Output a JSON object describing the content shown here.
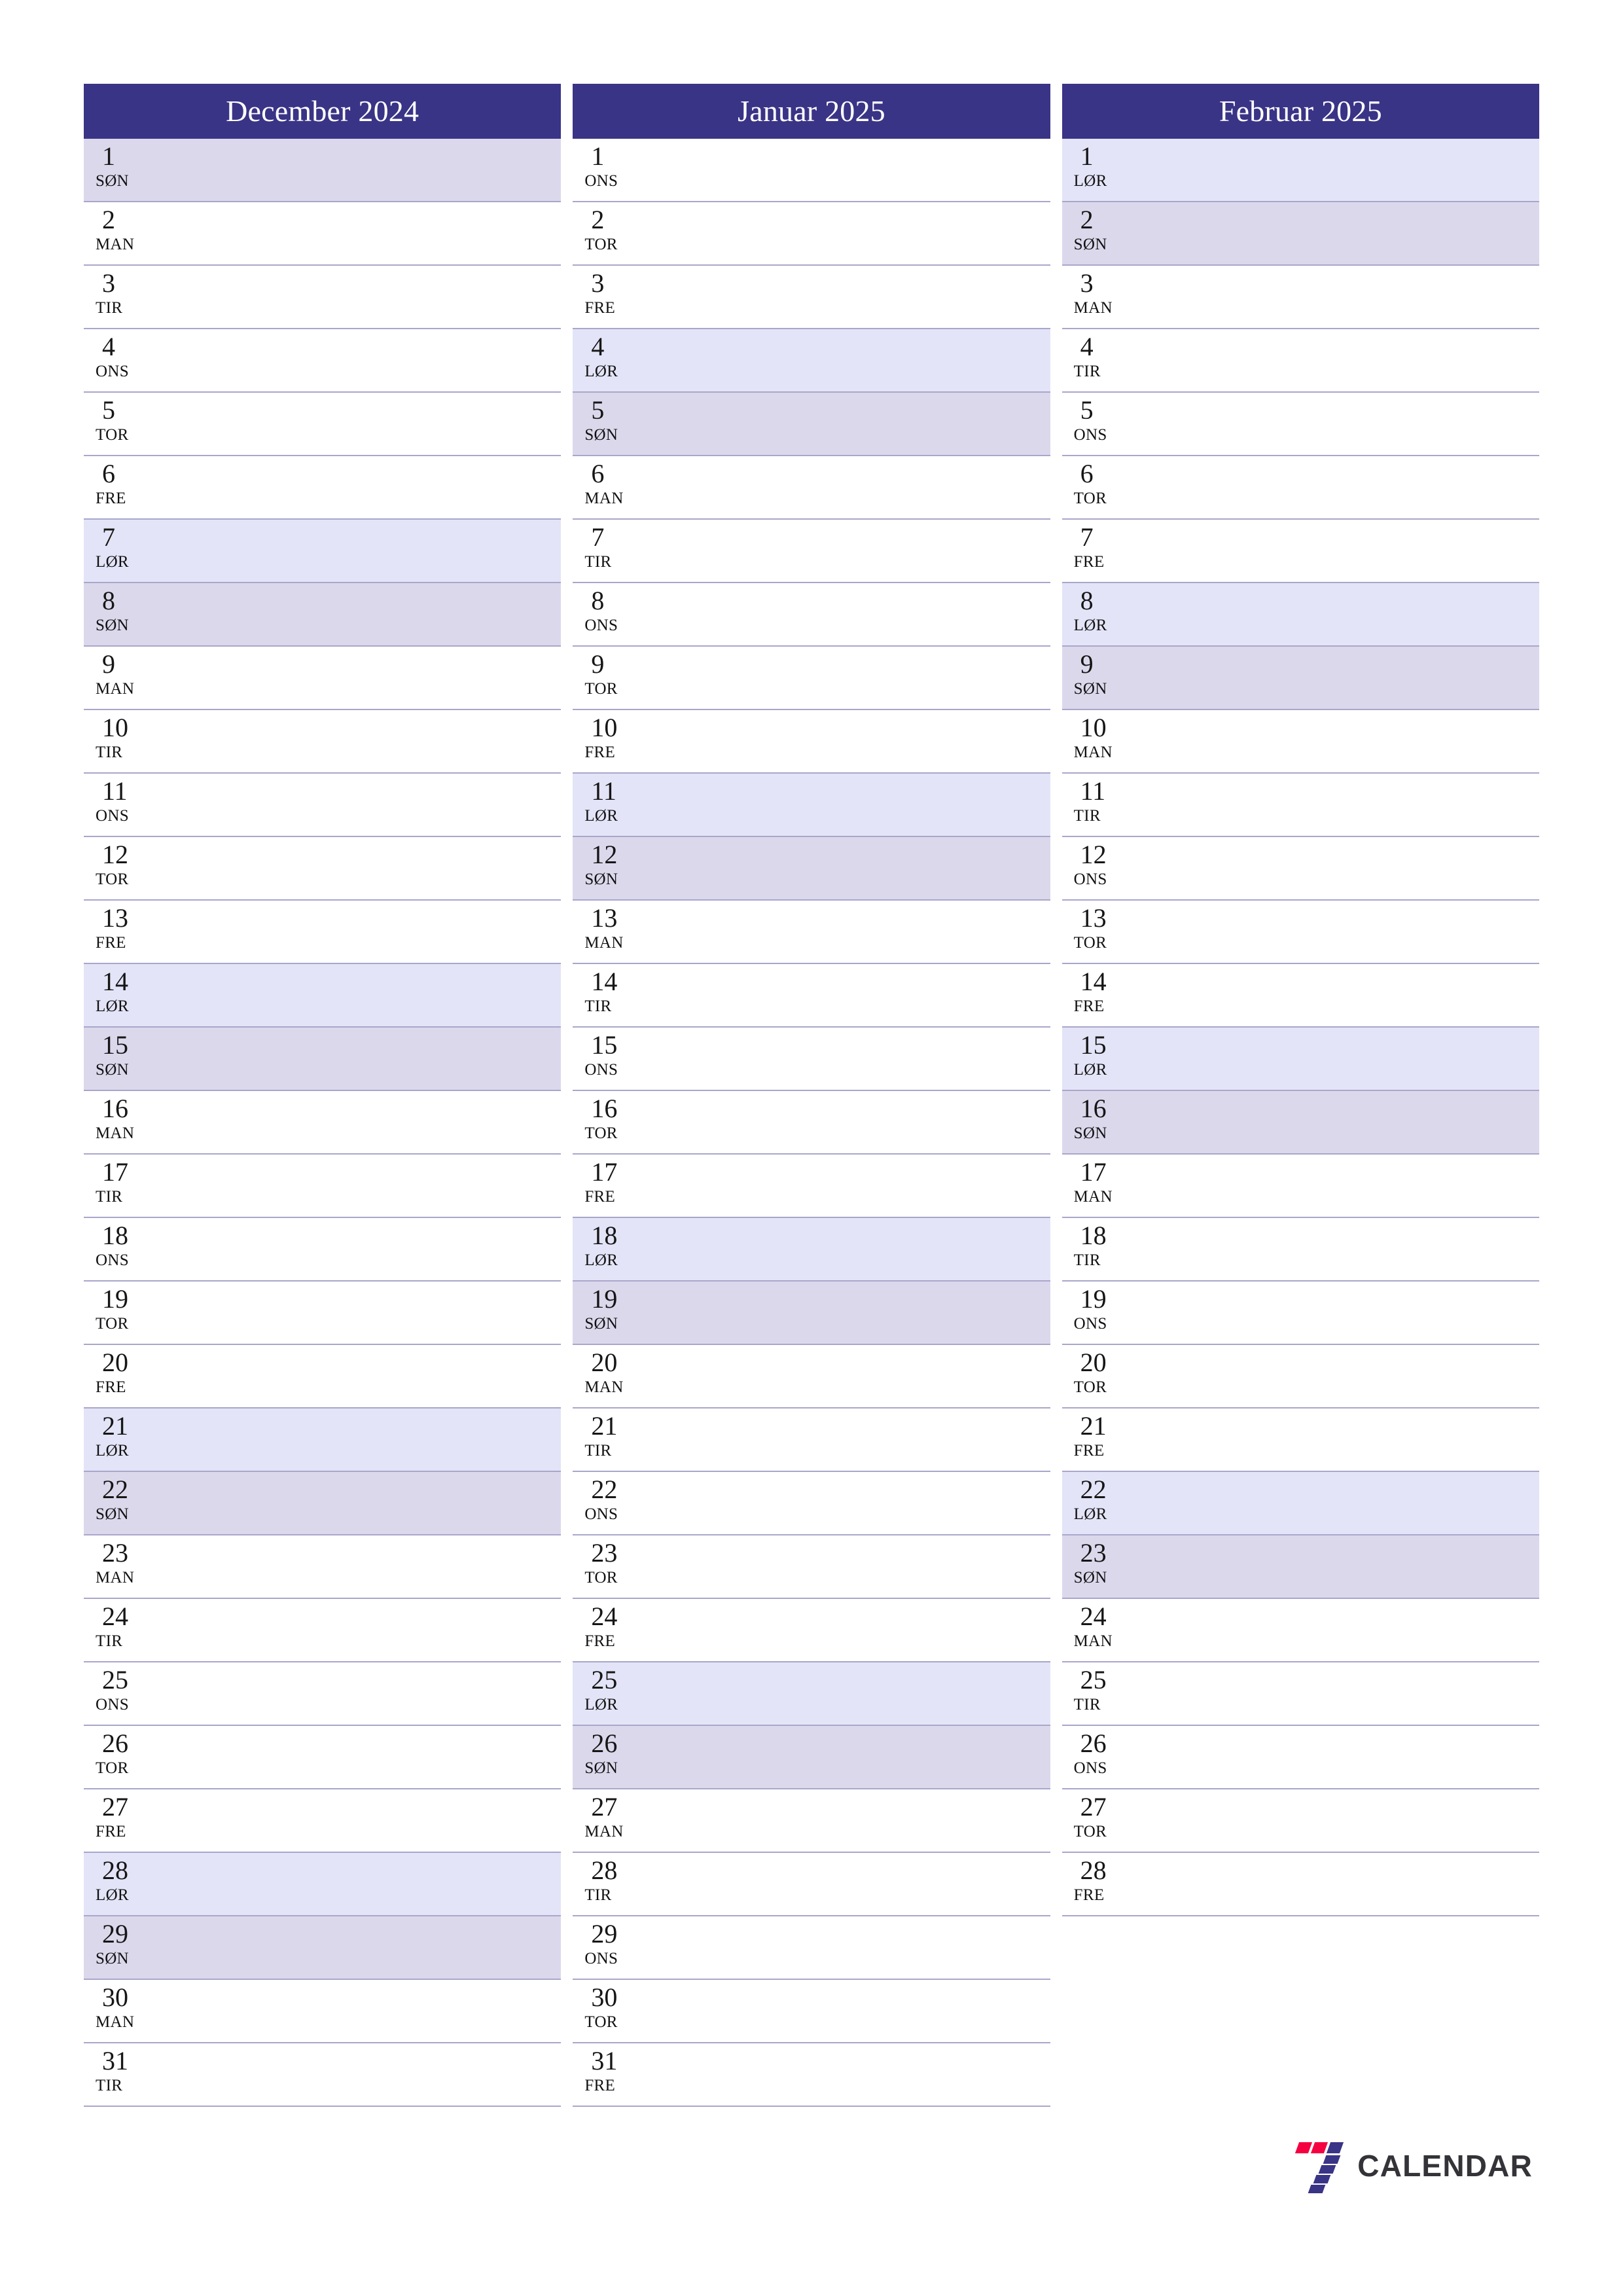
{
  "theme": {
    "header_bg": "#3a3486",
    "header_text": "#ffffff",
    "saturday_bg": "#e3e4f7",
    "sunday_bg": "#dcd8ec",
    "row_border": "#a9a6cb",
    "day_text": "#161616",
    "logo_red": "#f50040",
    "logo_indigo": "#3a3486",
    "logo_text_color": "#333338",
    "page_bg": "#ffffff"
  },
  "logo": {
    "text": "CALENDAR",
    "mark_name": "seven-logo-mark"
  },
  "months": [
    {
      "title": "December 2024",
      "days": [
        {
          "num": "1",
          "dow": "SØN",
          "type": "sun"
        },
        {
          "num": "2",
          "dow": "MAN",
          "type": "weekday"
        },
        {
          "num": "3",
          "dow": "TIR",
          "type": "weekday"
        },
        {
          "num": "4",
          "dow": "ONS",
          "type": "weekday"
        },
        {
          "num": "5",
          "dow": "TOR",
          "type": "weekday"
        },
        {
          "num": "6",
          "dow": "FRE",
          "type": "weekday"
        },
        {
          "num": "7",
          "dow": "LØR",
          "type": "sat"
        },
        {
          "num": "8",
          "dow": "SØN",
          "type": "sun"
        },
        {
          "num": "9",
          "dow": "MAN",
          "type": "weekday"
        },
        {
          "num": "10",
          "dow": "TIR",
          "type": "weekday"
        },
        {
          "num": "11",
          "dow": "ONS",
          "type": "weekday"
        },
        {
          "num": "12",
          "dow": "TOR",
          "type": "weekday"
        },
        {
          "num": "13",
          "dow": "FRE",
          "type": "weekday"
        },
        {
          "num": "14",
          "dow": "LØR",
          "type": "sat"
        },
        {
          "num": "15",
          "dow": "SØN",
          "type": "sun"
        },
        {
          "num": "16",
          "dow": "MAN",
          "type": "weekday"
        },
        {
          "num": "17",
          "dow": "TIR",
          "type": "weekday"
        },
        {
          "num": "18",
          "dow": "ONS",
          "type": "weekday"
        },
        {
          "num": "19",
          "dow": "TOR",
          "type": "weekday"
        },
        {
          "num": "20",
          "dow": "FRE",
          "type": "weekday"
        },
        {
          "num": "21",
          "dow": "LØR",
          "type": "sat"
        },
        {
          "num": "22",
          "dow": "SØN",
          "type": "sun"
        },
        {
          "num": "23",
          "dow": "MAN",
          "type": "weekday"
        },
        {
          "num": "24",
          "dow": "TIR",
          "type": "weekday"
        },
        {
          "num": "25",
          "dow": "ONS",
          "type": "weekday"
        },
        {
          "num": "26",
          "dow": "TOR",
          "type": "weekday"
        },
        {
          "num": "27",
          "dow": "FRE",
          "type": "weekday"
        },
        {
          "num": "28",
          "dow": "LØR",
          "type": "sat"
        },
        {
          "num": "29",
          "dow": "SØN",
          "type": "sun"
        },
        {
          "num": "30",
          "dow": "MAN",
          "type": "weekday"
        },
        {
          "num": "31",
          "dow": "TIR",
          "type": "weekday"
        }
      ]
    },
    {
      "title": "Januar 2025",
      "days": [
        {
          "num": "1",
          "dow": "ONS",
          "type": "weekday"
        },
        {
          "num": "2",
          "dow": "TOR",
          "type": "weekday"
        },
        {
          "num": "3",
          "dow": "FRE",
          "type": "weekday"
        },
        {
          "num": "4",
          "dow": "LØR",
          "type": "sat"
        },
        {
          "num": "5",
          "dow": "SØN",
          "type": "sun"
        },
        {
          "num": "6",
          "dow": "MAN",
          "type": "weekday"
        },
        {
          "num": "7",
          "dow": "TIR",
          "type": "weekday"
        },
        {
          "num": "8",
          "dow": "ONS",
          "type": "weekday"
        },
        {
          "num": "9",
          "dow": "TOR",
          "type": "weekday"
        },
        {
          "num": "10",
          "dow": "FRE",
          "type": "weekday"
        },
        {
          "num": "11",
          "dow": "LØR",
          "type": "sat"
        },
        {
          "num": "12",
          "dow": "SØN",
          "type": "sun"
        },
        {
          "num": "13",
          "dow": "MAN",
          "type": "weekday"
        },
        {
          "num": "14",
          "dow": "TIR",
          "type": "weekday"
        },
        {
          "num": "15",
          "dow": "ONS",
          "type": "weekday"
        },
        {
          "num": "16",
          "dow": "TOR",
          "type": "weekday"
        },
        {
          "num": "17",
          "dow": "FRE",
          "type": "weekday"
        },
        {
          "num": "18",
          "dow": "LØR",
          "type": "sat"
        },
        {
          "num": "19",
          "dow": "SØN",
          "type": "sun"
        },
        {
          "num": "20",
          "dow": "MAN",
          "type": "weekday"
        },
        {
          "num": "21",
          "dow": "TIR",
          "type": "weekday"
        },
        {
          "num": "22",
          "dow": "ONS",
          "type": "weekday"
        },
        {
          "num": "23",
          "dow": "TOR",
          "type": "weekday"
        },
        {
          "num": "24",
          "dow": "FRE",
          "type": "weekday"
        },
        {
          "num": "25",
          "dow": "LØR",
          "type": "sat"
        },
        {
          "num": "26",
          "dow": "SØN",
          "type": "sun"
        },
        {
          "num": "27",
          "dow": "MAN",
          "type": "weekday"
        },
        {
          "num": "28",
          "dow": "TIR",
          "type": "weekday"
        },
        {
          "num": "29",
          "dow": "ONS",
          "type": "weekday"
        },
        {
          "num": "30",
          "dow": "TOR",
          "type": "weekday"
        },
        {
          "num": "31",
          "dow": "FRE",
          "type": "weekday"
        }
      ]
    },
    {
      "title": "Februar 2025",
      "days": [
        {
          "num": "1",
          "dow": "LØR",
          "type": "sat"
        },
        {
          "num": "2",
          "dow": "SØN",
          "type": "sun"
        },
        {
          "num": "3",
          "dow": "MAN",
          "type": "weekday"
        },
        {
          "num": "4",
          "dow": "TIR",
          "type": "weekday"
        },
        {
          "num": "5",
          "dow": "ONS",
          "type": "weekday"
        },
        {
          "num": "6",
          "dow": "TOR",
          "type": "weekday"
        },
        {
          "num": "7",
          "dow": "FRE",
          "type": "weekday"
        },
        {
          "num": "8",
          "dow": "LØR",
          "type": "sat"
        },
        {
          "num": "9",
          "dow": "SØN",
          "type": "sun"
        },
        {
          "num": "10",
          "dow": "MAN",
          "type": "weekday"
        },
        {
          "num": "11",
          "dow": "TIR",
          "type": "weekday"
        },
        {
          "num": "12",
          "dow": "ONS",
          "type": "weekday"
        },
        {
          "num": "13",
          "dow": "TOR",
          "type": "weekday"
        },
        {
          "num": "14",
          "dow": "FRE",
          "type": "weekday"
        },
        {
          "num": "15",
          "dow": "LØR",
          "type": "sat"
        },
        {
          "num": "16",
          "dow": "SØN",
          "type": "sun"
        },
        {
          "num": "17",
          "dow": "MAN",
          "type": "weekday"
        },
        {
          "num": "18",
          "dow": "TIR",
          "type": "weekday"
        },
        {
          "num": "19",
          "dow": "ONS",
          "type": "weekday"
        },
        {
          "num": "20",
          "dow": "TOR",
          "type": "weekday"
        },
        {
          "num": "21",
          "dow": "FRE",
          "type": "weekday"
        },
        {
          "num": "22",
          "dow": "LØR",
          "type": "sat"
        },
        {
          "num": "23",
          "dow": "SØN",
          "type": "sun"
        },
        {
          "num": "24",
          "dow": "MAN",
          "type": "weekday"
        },
        {
          "num": "25",
          "dow": "TIR",
          "type": "weekday"
        },
        {
          "num": "26",
          "dow": "ONS",
          "type": "weekday"
        },
        {
          "num": "27",
          "dow": "TOR",
          "type": "weekday"
        },
        {
          "num": "28",
          "dow": "FRE",
          "type": "weekday"
        }
      ]
    }
  ]
}
